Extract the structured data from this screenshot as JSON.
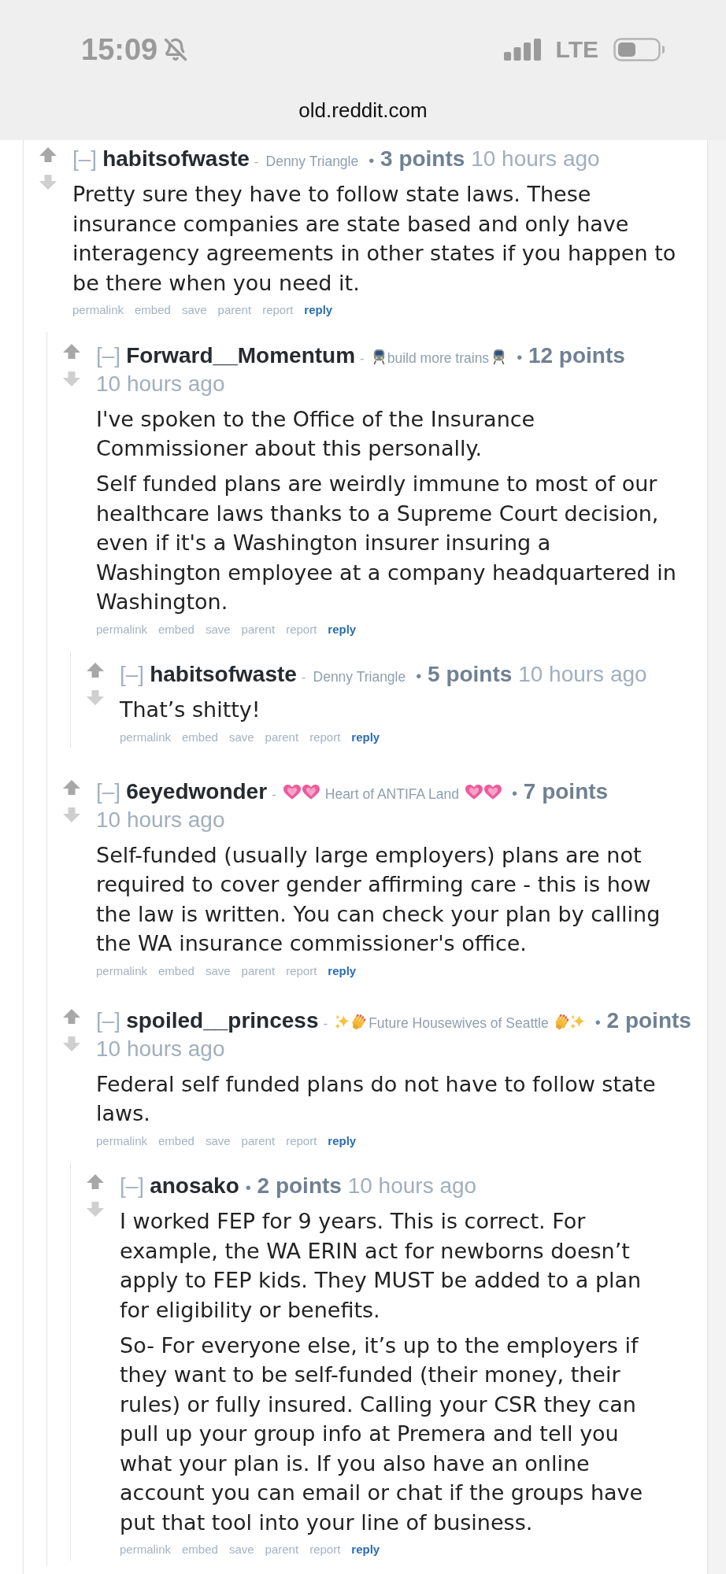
{
  "status_bar": {
    "time": "15:09",
    "network": "LTE"
  },
  "address_bar": {
    "url": "old.reddit.com"
  },
  "comments": [
    {
      "collapse": "[–]",
      "author": "habitsofwaste",
      "flair": {
        "kind": "plain",
        "separator": "-",
        "text": "Denny Triangle"
      },
      "bullet": "•",
      "points": "3 points",
      "time": "10 hours ago",
      "paragraphs": [
        "Pretty sure they have to follow state laws. These insurance companies are state based and only have interagency agreements in other states if you happen to be there when you need it."
      ],
      "actions": [
        {
          "label": "permalink",
          "kind": "link"
        },
        {
          "label": "embed",
          "kind": "link"
        },
        {
          "label": "save",
          "kind": "link"
        },
        {
          "label": "parent",
          "kind": "link"
        },
        {
          "label": "report",
          "kind": "link"
        },
        {
          "label": "reply",
          "kind": "primary"
        }
      ],
      "children": [
        {
          "collapse": "[–]",
          "author": "Forward__Momentum",
          "flair": {
            "kind": "train",
            "separator": "-",
            "text": "build more trains"
          },
          "bullet": "•",
          "points": "12 points",
          "time": "10 hours ago",
          "paragraphs": [
            "I've spoken to the Office of the Insurance Commissioner about this personally.",
            "Self funded plans are weirdly immune to most of our healthcare laws thanks to a Supreme Court decision, even if it's a Washington insurer insuring a Washington employee at a company headquartered in Washington."
          ],
          "actions": [
            {
              "label": "permalink",
              "kind": "link"
            },
            {
              "label": "embed",
              "kind": "link"
            },
            {
              "label": "save",
              "kind": "link"
            },
            {
              "label": "parent",
              "kind": "link"
            },
            {
              "label": "report",
              "kind": "link"
            },
            {
              "label": "reply",
              "kind": "primary"
            }
          ],
          "children": [
            {
              "collapse": "[–]",
              "author": "habitsofwaste",
              "flair": {
                "kind": "plain",
                "separator": "-",
                "text": "Denny Triangle"
              },
              "bullet": "•",
              "points": "5 points",
              "time": "10 hours ago",
              "paragraphs": [
                "That’s shitty!"
              ],
              "actions": [
                {
                  "label": "permalink",
                  "kind": "link"
                },
                {
                  "label": "embed",
                  "kind": "link"
                },
                {
                  "label": "save",
                  "kind": "link"
                },
                {
                  "label": "parent",
                  "kind": "link"
                },
                {
                  "label": "report",
                  "kind": "link"
                },
                {
                  "label": "reply",
                  "kind": "primary"
                }
              ]
            }
          ]
        },
        {
          "collapse": "[–]",
          "author": "6eyedwonder",
          "flair": {
            "kind": "hearts",
            "separator": "-",
            "text": "Heart of ANTIFA Land"
          },
          "bullet": "•",
          "points": "7 points",
          "time": "10 hours ago",
          "paragraphs": [
            "Self-funded (usually large employers) plans are not required to cover gender affirming care - this is how the law is written. You can check your plan by calling the WA insurance commissioner's office."
          ],
          "actions": [
            {
              "label": "permalink",
              "kind": "link"
            },
            {
              "label": "embed",
              "kind": "link"
            },
            {
              "label": "save",
              "kind": "link"
            },
            {
              "label": "parent",
              "kind": "link"
            },
            {
              "label": "report",
              "kind": "link"
            },
            {
              "label": "reply",
              "kind": "primary"
            }
          ]
        },
        {
          "collapse": "[–]",
          "author": "spoiled__princess",
          "flair": {
            "kind": "sparkles",
            "separator": "-",
            "text": "Future Housewives of Seattle"
          },
          "bullet": "•",
          "points": "2 points",
          "time": "10 hours ago",
          "paragraphs": [
            "Federal self funded plans do not have to follow state laws."
          ],
          "actions": [
            {
              "label": "permalink",
              "kind": "link"
            },
            {
              "label": "embed",
              "kind": "link"
            },
            {
              "label": "save",
              "kind": "link"
            },
            {
              "label": "parent",
              "kind": "link"
            },
            {
              "label": "report",
              "kind": "link"
            },
            {
              "label": "reply",
              "kind": "primary"
            }
          ],
          "children": [
            {
              "collapse": "[–]",
              "author": "anosako",
              "bullet": "•",
              "points": "2 points",
              "time": "10 hours ago",
              "paragraphs": [
                "I worked FEP for 9 years. This is correct. For example, the WA ERIN act for newborns doesn’t apply to FEP kids. They MUST be added to a plan for eligibility or benefits.",
                "So- For everyone else, it’s up to the employers if they want to be self-funded (their money, their rules) or fully insured. Calling your CSR they can pull up your group info at Premera and tell you what your plan is. If you also have an online account you can email or chat if the groups have put that tool into your line of business."
              ],
              "actions": [
                {
                  "label": "permalink",
                  "kind": "link"
                },
                {
                  "label": "embed",
                  "kind": "link"
                },
                {
                  "label": "save",
                  "kind": "link"
                },
                {
                  "label": "parent",
                  "kind": "link"
                },
                {
                  "label": "report",
                  "kind": "link"
                },
                {
                  "label": "reply",
                  "kind": "primary"
                }
              ]
            }
          ]
        }
      ]
    }
  ]
}
